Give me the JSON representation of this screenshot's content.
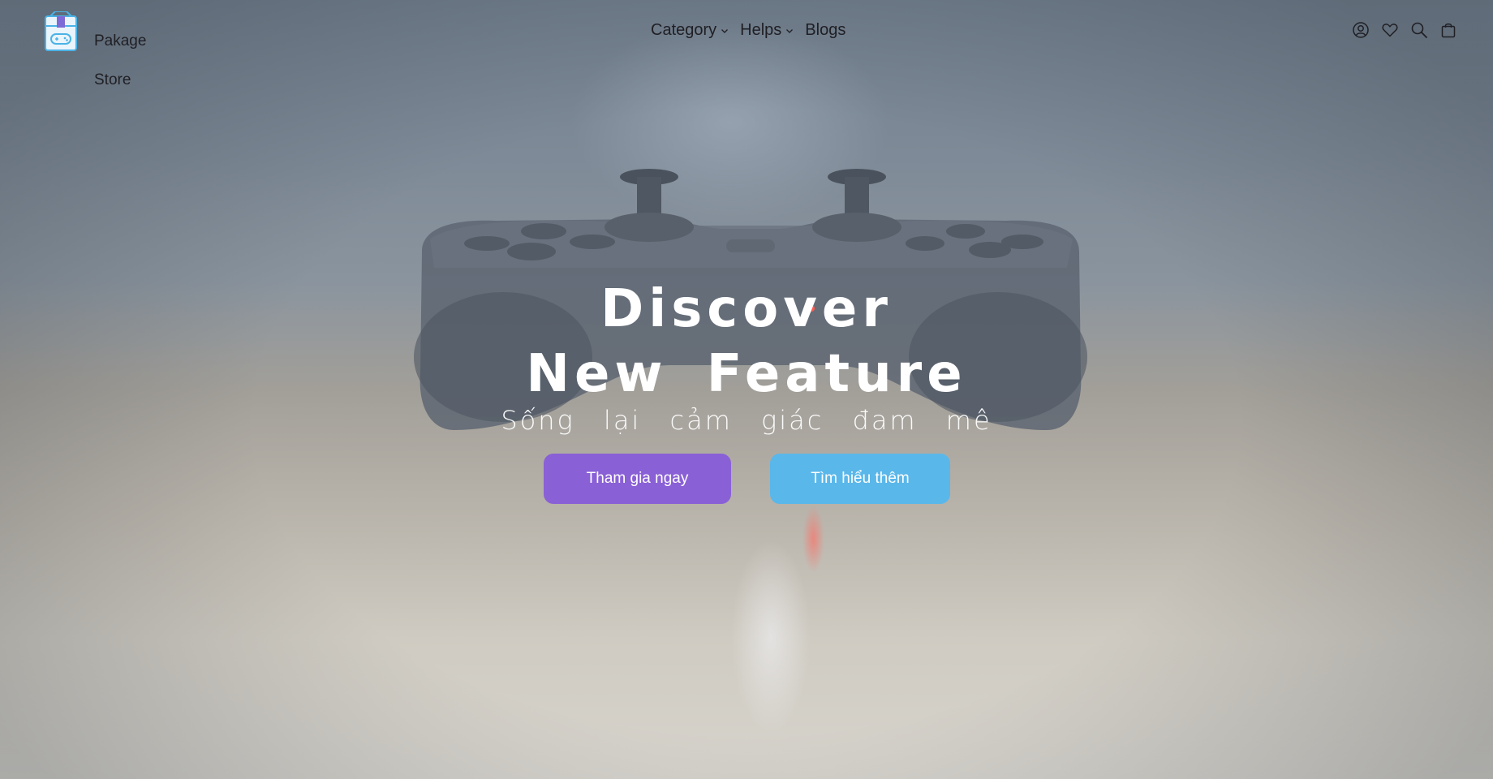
{
  "brand": {
    "line1": "Pakage",
    "line2": "Store",
    "logo_icon": "gamepad-box-icon"
  },
  "nav": {
    "items": [
      {
        "label": "Category",
        "has_dropdown": true
      },
      {
        "label": "Helps",
        "has_dropdown": true
      },
      {
        "label": "Blogs",
        "has_dropdown": false
      }
    ]
  },
  "header_icons": [
    "user-icon",
    "heart-icon",
    "search-icon",
    "shopping-bag-icon"
  ],
  "hero": {
    "title_line1": "Discover",
    "title_line2": "New Feature",
    "subtitle": "Sống lại cảm giác đam mê",
    "primary_button": "Tham gia ngay",
    "secondary_button": "Tìm hiểu thêm"
  },
  "colors": {
    "primary_button": "#8a60d6",
    "secondary_button": "#5ab7ea",
    "text_dark": "#1f1f24",
    "hero_text": "#ffffff"
  }
}
